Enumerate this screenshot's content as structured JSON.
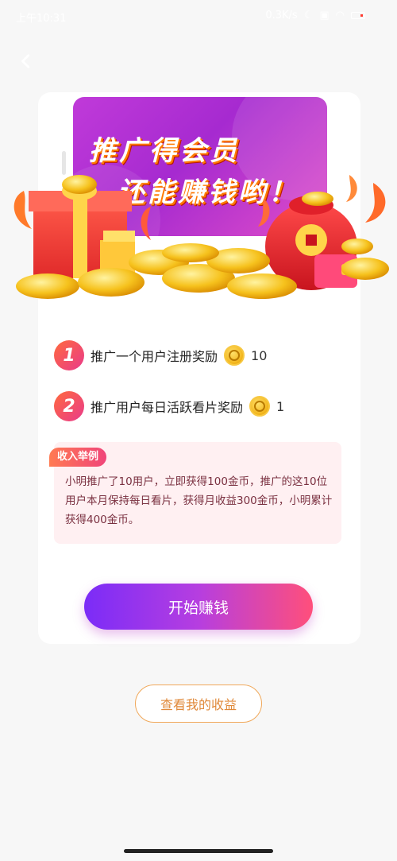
{
  "status_bar": {
    "time": "上午10:31",
    "network_speed": "0.3K/s"
  },
  "banner": {
    "line1": "推广得会员",
    "line2": "还能赚钱哟！"
  },
  "rewards": [
    {
      "num": "1",
      "text": "推广一个用户注册奖励",
      "value": "10"
    },
    {
      "num": "2",
      "text": "推广用户每日活跃看片奖励",
      "value": "1"
    }
  ],
  "example": {
    "tag": "收入举例",
    "text": "小明推广了10用户，立即获得100金币，推广的这10位用户本月保持每日看片，获得月收益300金币，小明累计获得400金币。"
  },
  "buttons": {
    "start": "开始赚钱",
    "my_earnings": "查看我的收益"
  },
  "colors": {
    "accent_gradient_start": "#7b2cf7",
    "accent_gradient_end": "#ff4f7b",
    "outline_orange": "#f0a85a"
  }
}
